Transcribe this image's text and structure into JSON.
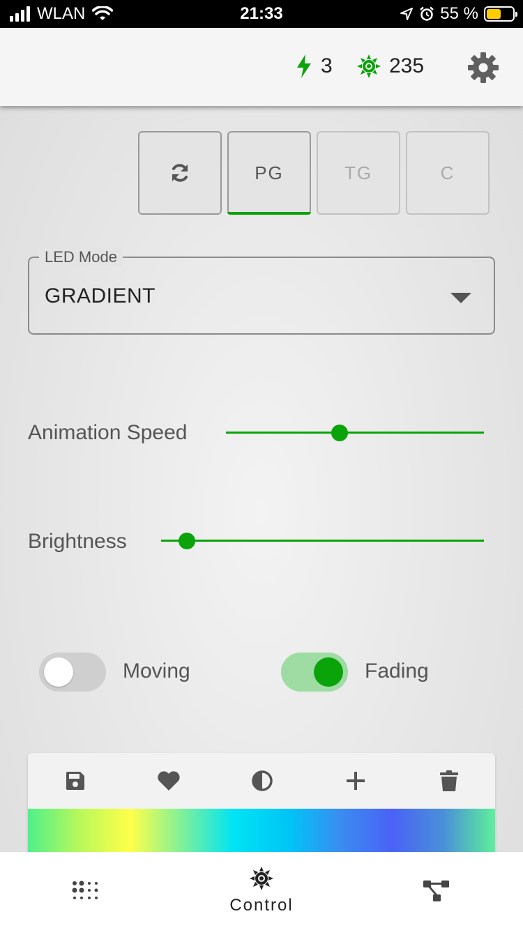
{
  "status_bar": {
    "carrier": "WLAN",
    "time": "21:33",
    "battery_percent": "55 %",
    "battery_level": 0.55
  },
  "header": {
    "power_count": "3",
    "led_count": "235",
    "accent_color": "#0aa30a"
  },
  "mode_buttons": {
    "refresh_icon": "refresh-icon",
    "buttons": [
      {
        "label": "PG",
        "active": true,
        "enabled": true
      },
      {
        "label": "TG",
        "active": false,
        "enabled": false
      },
      {
        "label": "C",
        "active": false,
        "enabled": false
      }
    ]
  },
  "led_mode": {
    "label": "LED Mode",
    "value": "GRADIENT"
  },
  "sliders": {
    "animation_speed": {
      "label": "Animation Speed",
      "value": 0.44
    },
    "brightness": {
      "label": "Brightness",
      "value": 0.08
    }
  },
  "toggles": {
    "moving": {
      "label": "Moving",
      "on": false
    },
    "fading": {
      "label": "Fading",
      "on": true
    }
  },
  "palette": {
    "tools": [
      "save-icon",
      "heart-icon",
      "contrast-icon",
      "plus-icon",
      "trash-icon"
    ],
    "gradient_colors": [
      "#4ff08a",
      "#b8f85a",
      "#ffff4a",
      "#7ff09a",
      "#00e4f4",
      "#00c4f6",
      "#3a8cf0",
      "#4a62f6",
      "#4a90d8",
      "#5ef09a"
    ]
  },
  "bottom_nav": {
    "items": [
      {
        "icon": "dots-grid-icon",
        "label": ""
      },
      {
        "icon": "sun-icon",
        "label": "Control"
      },
      {
        "icon": "tree-icon",
        "label": ""
      }
    ]
  }
}
